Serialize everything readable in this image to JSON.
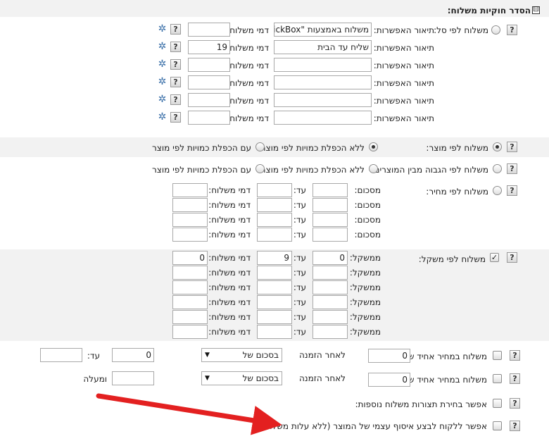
{
  "section": {
    "title": "הסדר חוקיות משלוח:",
    "collapse_glyph": "⊟"
  },
  "help_glyph": "?",
  "gear_glyph": "✲",
  "checkmark_glyph": "✓",
  "dropdown_arrow": "▼",
  "cart_options": {
    "label": "משלוח לפי סל:",
    "desc_label": "תיאור האפשרות:",
    "fee_label": "דמי משלוח:",
    "rows": [
      {
        "desc": "משלוח באמצעות \"QuickBox",
        "fee": ""
      },
      {
        "desc": "שליח עד הבית",
        "fee": "19"
      },
      {
        "desc": "",
        "fee": ""
      },
      {
        "desc": "",
        "fee": ""
      },
      {
        "desc": "",
        "fee": ""
      },
      {
        "desc": "",
        "fee": ""
      }
    ]
  },
  "by_product": {
    "label": "משלוח לפי מוצר:",
    "no_mult": "ללא הכפלת כמויות לפי מוצר",
    "with_mult": "עם הכפלת כמויות לפי מוצר"
  },
  "by_highest": {
    "label": "משלוח לפי הגבוה מבין המוצרים:",
    "no_mult": "ללא הכפלת כמויות לפי מוצר",
    "with_mult": "עם הכפלת כמויות לפי מוצר"
  },
  "by_price": {
    "label": "משלוח לפי מחיר:",
    "from_label": "מסכום:",
    "to_label": "עד:",
    "fee_label": "דמי משלוח:",
    "rows": [
      {
        "from": "",
        "to": "",
        "fee": ""
      },
      {
        "from": "",
        "to": "",
        "fee": ""
      },
      {
        "from": "",
        "to": "",
        "fee": ""
      },
      {
        "from": "",
        "to": "",
        "fee": ""
      }
    ]
  },
  "by_weight": {
    "label": "משלוח לפי משקל:",
    "from_label": "ממשקל:",
    "to_label": "עד:",
    "fee_label": "דמי משלוח:",
    "rows": [
      {
        "from": "0",
        "to": "9",
        "fee": "0"
      },
      {
        "from": "",
        "to": "",
        "fee": ""
      },
      {
        "from": "",
        "to": "",
        "fee": ""
      },
      {
        "from": "",
        "to": "",
        "fee": ""
      },
      {
        "from": "",
        "to": "",
        "fee": ""
      },
      {
        "from": "",
        "to": "",
        "fee": ""
      }
    ]
  },
  "unit_price": {
    "label": "משלוח במחיר אחיד של",
    "after_order": "לאחר הזמנה",
    "select_value": "בסכום של",
    "row1": {
      "price": "0",
      "amount": "0",
      "to_label": "עד:",
      "to_value": ""
    },
    "row2": {
      "price": "0",
      "amount": "",
      "suffix": "ומעלה"
    }
  },
  "extra": {
    "additional_label": "אפשר בחירת תצורות משלוח נוספות:",
    "pickup_label": "אפשר ללקוח לבצע איסוף עצמי של המוצר (ללא עלות משלוח)"
  },
  "colors": {
    "arrow": "#e32020",
    "band": "#f2f2f2",
    "gear": "#3a6fa8"
  }
}
